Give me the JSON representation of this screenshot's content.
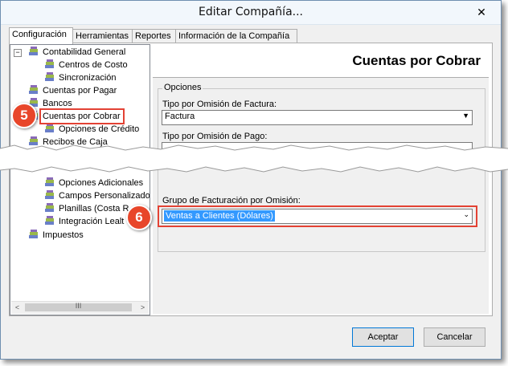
{
  "window": {
    "title": "Editar Compañía..."
  },
  "icons": {
    "close": "close-icon",
    "node": "stacked-books-icon"
  },
  "tabs": [
    {
      "label": "Configuración"
    },
    {
      "label": "Herramientas"
    },
    {
      "label": "Reportes"
    },
    {
      "label": "Información de la Compañía"
    }
  ],
  "tree": {
    "items": [
      {
        "label": "Contabilidad General"
      },
      {
        "label": "Centros de Costo"
      },
      {
        "label": "Sincronización"
      },
      {
        "label": "Cuentas por Pagar"
      },
      {
        "label": "Bancos"
      },
      {
        "label": "Cuentas por Cobrar"
      },
      {
        "label": "Opciones de Crédito"
      },
      {
        "label": "Recibos de Caja"
      },
      {
        "label": "Opciones Adicionales"
      },
      {
        "label": "Campos Personalizados"
      },
      {
        "label": "Planillas (Costa R"
      },
      {
        "label": "Integración Lealt"
      },
      {
        "label": "Impuestos"
      }
    ],
    "scroll_grip": "III"
  },
  "panel": {
    "heading": "Cuentas por Cobrar",
    "group_title": "Opciones",
    "invoice_type_label": "Tipo por Omisión de Factura:",
    "invoice_type_value": "Factura",
    "payment_type_label": "Tipo por Omisión de Pago:",
    "billing_group_label": "Grupo de Facturación por Omisión:",
    "billing_group_value": "Ventas a Clientes (Dólares)"
  },
  "callouts": {
    "step5": "5",
    "step6": "6"
  },
  "buttons": {
    "accept": "Aceptar",
    "cancel": "Cancelar"
  },
  "colors": {
    "callout": "#e8462a",
    "highlight_box": "#e34234",
    "selection": "#3399ff"
  }
}
